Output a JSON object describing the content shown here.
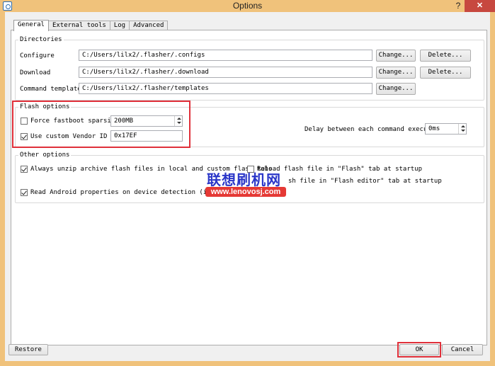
{
  "window": {
    "title": "Options",
    "help": "?",
    "close": "✕"
  },
  "tabs": [
    "General",
    "External tools",
    "Log",
    "Advanced"
  ],
  "directories": {
    "title": "Directories",
    "rows": [
      {
        "label": "Configure",
        "value": "C:/Users/lilx2/.flasher/.configs",
        "change": "Change...",
        "delete": "Delete..."
      },
      {
        "label": "Download",
        "value": "C:/Users/lilx2/.flasher/.download",
        "change": "Change...",
        "delete": "Delete..."
      },
      {
        "label": "Command templates",
        "value": "C:/Users/lilx2/.flasher/templates",
        "change": "Change..."
      }
    ]
  },
  "flash": {
    "title": "Flash options",
    "force_sparsing": {
      "label": "Force fastboot sparsing",
      "checked": false,
      "value": "200MB"
    },
    "vendor_id": {
      "label": "Use custom Vendor ID",
      "checked": true,
      "value": "0x17EF"
    },
    "delay": {
      "label": "Delay between each command execution",
      "value": "0ms"
    }
  },
  "other": {
    "title": "Other options",
    "unzip": {
      "label": "Always unzip archive flash files in local and custom flash tabs",
      "checked": true
    },
    "reload_flash": {
      "label": "Reload flash file in \"Flash\" tab at startup",
      "checked": false
    },
    "reload_editor": {
      "label": "sh file in \"Flash editor\" tab at startup"
    },
    "read_props": {
      "label": "Read Android properties on device detection (in MOS)",
      "checked": true
    }
  },
  "watermark": {
    "cn": "联想刷机网",
    "url": "www.lenovosj.com"
  },
  "footer": {
    "restore": "Restore",
    "ok": "OK",
    "cancel": "Cancel"
  },
  "colors": {
    "frame": "#f0c27b",
    "close_bg": "#c7483f",
    "highlight": "#e0303a"
  }
}
